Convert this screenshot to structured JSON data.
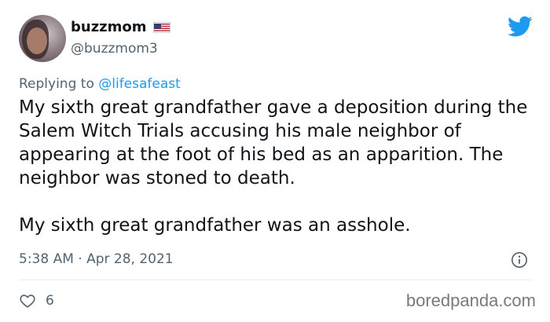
{
  "user": {
    "display_name": "buzzmom",
    "handle": "@buzzmom3",
    "flag_icon": "us-flag-icon"
  },
  "reply": {
    "prefix": "Replying to ",
    "mention": "@lifesafeast"
  },
  "tweet": {
    "paragraphs": [
      "My sixth great grandfather gave a deposition during the Salem Witch Trials accusing his male neighbor of appearing at the foot of his bed as an apparition. The neighbor was stoned to death.",
      "My sixth great grandfather was an asshole."
    ],
    "timestamp": "5:38 AM · Apr 28, 2021"
  },
  "actions": {
    "like_count": "6",
    "like_icon": "heart-icon",
    "info_icon": "info-icon"
  },
  "watermark": "boredpanda.com",
  "colors": {
    "twitter_blue": "#1d9bf0",
    "secondary_text": "#536471",
    "primary_text": "#0f1419"
  }
}
